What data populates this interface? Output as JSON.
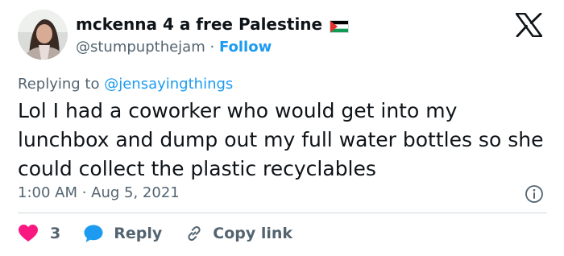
{
  "author": {
    "display_name": "mckenna 4 a free Palestine",
    "handle": "@stumpupthejam",
    "separator": "·",
    "follow_label": "Follow"
  },
  "reply": {
    "prefix": "Replying to",
    "mention": "@jensayingthings"
  },
  "tweet": {
    "text": "Lol I had a coworker who would get into my lunchbox and dump out my full water bottles so she could collect the plastic recyclables",
    "timestamp": "1:00 AM · Aug 5, 2021"
  },
  "actions": {
    "like_count": "3",
    "reply_label": "Reply",
    "copy_label": "Copy link"
  },
  "colors": {
    "accent": "#1d9bf0",
    "like": "#f91880",
    "text_primary": "#0f1419",
    "text_secondary": "#536471"
  },
  "icons": [
    "x-logo-icon",
    "palestine-flag-icon",
    "info-icon",
    "heart-icon",
    "reply-bubble-icon",
    "link-icon"
  ]
}
